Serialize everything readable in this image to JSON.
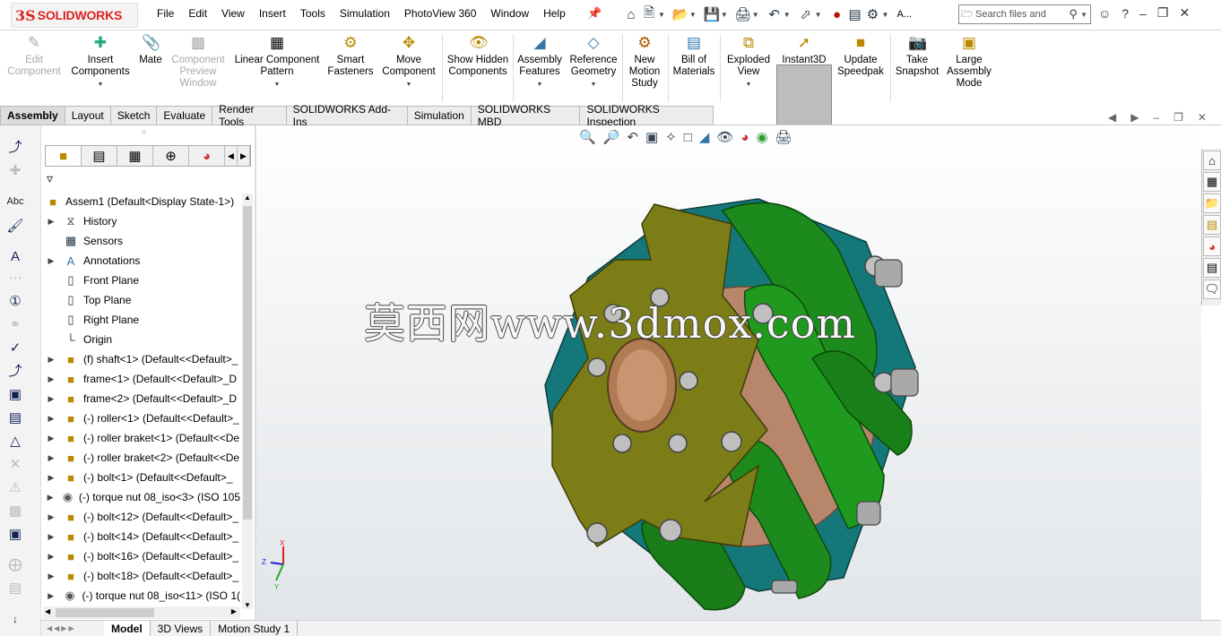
{
  "app": {
    "logo": "SOLIDWORKS",
    "logo_mark": "3S"
  },
  "menu": [
    "File",
    "Edit",
    "View",
    "Insert",
    "Tools",
    "Simulation",
    "PhotoView 360",
    "Window",
    "Help"
  ],
  "search": {
    "text": "Search files and",
    "label_a": "A..."
  },
  "ribbon": {
    "edit_component": "Edit Component",
    "insert_components": "Insert Components",
    "mate": "Mate",
    "component_preview": "Component Preview Window",
    "linear_pattern": "Linear Component Pattern",
    "smart_fasteners": "Smart Fasteners",
    "move_component": "Move Component",
    "show_hidden": "Show Hidden Components",
    "assembly_features": "Assembly Features",
    "reference_geometry": "Reference Geometry",
    "new_motion_study": "New Motion Study",
    "bill_of_materials": "Bill of Materials",
    "exploded_view": "Exploded View",
    "instant3d": "Instant3D",
    "update_speedpak": "Update Speedpak",
    "take_snapshot": "Take Snapshot",
    "large_assembly": "Large Assembly Mode"
  },
  "tabs": [
    "Assembly",
    "Layout",
    "Sketch",
    "Evaluate",
    "Render Tools",
    "SOLIDWORKS Add-Ins",
    "Simulation",
    "SOLIDWORKS MBD",
    "SOLIDWORKS Inspection"
  ],
  "tree": {
    "root": "Assem1  (Default<Display State-1>)",
    "items": [
      {
        "label": "History",
        "icon": "history-icon"
      },
      {
        "label": "Sensors",
        "icon": "sensors-icon"
      },
      {
        "label": "Annotations",
        "icon": "annotations-icon"
      },
      {
        "label": "Front Plane",
        "icon": "plane-icon"
      },
      {
        "label": "Top Plane",
        "icon": "plane-icon"
      },
      {
        "label": "Right Plane",
        "icon": "plane-icon"
      },
      {
        "label": "Origin",
        "icon": "origin-icon"
      },
      {
        "label": "(f) shaft<1> (Default<<Default>_",
        "icon": "part-icon"
      },
      {
        "label": "frame<1> (Default<<Default>_D",
        "icon": "part-icon"
      },
      {
        "label": "frame<2> (Default<<Default>_D",
        "icon": "part-icon"
      },
      {
        "label": "(-) roller<1> (Default<<Default>_",
        "icon": "part-icon"
      },
      {
        "label": "(-) roller braket<1> (Default<<De",
        "icon": "part-icon"
      },
      {
        "label": "(-) roller braket<2> (Default<<De",
        "icon": "part-icon"
      },
      {
        "label": "(-) bolt<1> (Default<<Default>_",
        "icon": "part-icon"
      },
      {
        "label": "(-) torque nut 08_iso<3> (ISO 105",
        "icon": "nut-icon"
      },
      {
        "label": "(-) bolt<12> (Default<<Default>_",
        "icon": "part-icon"
      },
      {
        "label": "(-) bolt<14> (Default<<Default>_",
        "icon": "part-icon"
      },
      {
        "label": "(-) bolt<16> (Default<<Default>_",
        "icon": "part-icon"
      },
      {
        "label": "(-) bolt<18> (Default<<Default>_",
        "icon": "part-icon"
      },
      {
        "label": "(-) torque nut 08_iso<11> (ISO 1(",
        "icon": "nut-icon"
      }
    ]
  },
  "bottom_tabs": [
    "Model",
    "3D Views",
    "Motion Study 1"
  ],
  "watermark": "莫西网www.3dmox.com",
  "triad": {
    "x": "X",
    "y": "Y",
    "z": "Z"
  },
  "colors": {
    "frame": "#7d7d18",
    "roller": "#1c8a1c",
    "bracket": "#14787a",
    "hub": "#b8866a",
    "accent": "#cc2222"
  }
}
